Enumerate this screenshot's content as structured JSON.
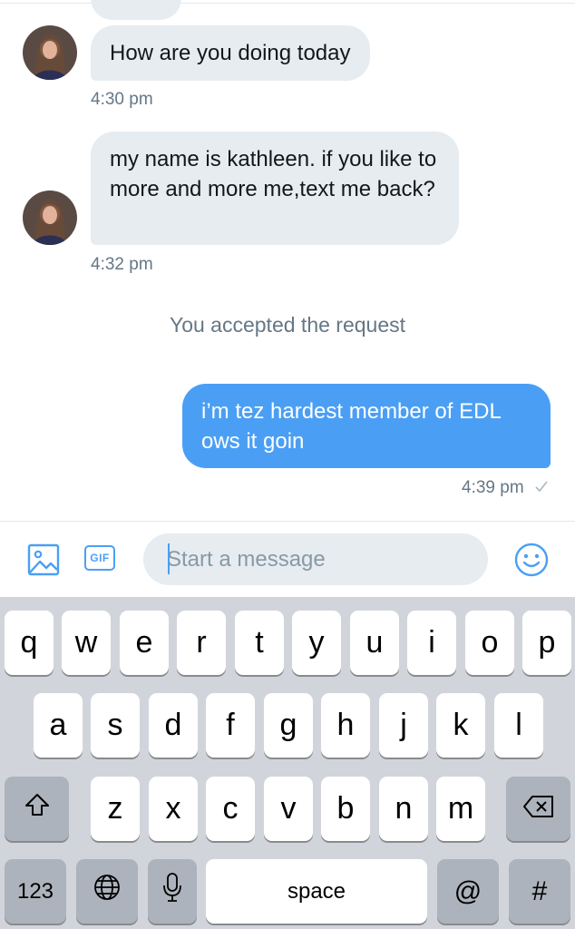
{
  "conversation": {
    "messages": [
      {
        "direction": "in",
        "text": "How are you doing today",
        "time": "4:30 pm"
      },
      {
        "direction": "in",
        "text": "my name is kathleen. if you like to more and more me,text me back?",
        "time": "4:32 pm"
      },
      {
        "direction": "out",
        "text": "i’m tez hardest member of EDL ows it goin",
        "time": "4:39 pm",
        "status_icon": "check-icon"
      }
    ],
    "system_notice": "You accepted the request"
  },
  "composer": {
    "placeholder": "Start a message",
    "media_icon": "image-icon",
    "gif_label": "GIF",
    "emoji_icon": "smiley-icon"
  },
  "keyboard": {
    "row1": [
      "q",
      "w",
      "e",
      "r",
      "t",
      "y",
      "u",
      "i",
      "o",
      "p"
    ],
    "row2": [
      "a",
      "s",
      "d",
      "f",
      "g",
      "h",
      "j",
      "k",
      "l"
    ],
    "row3": [
      "z",
      "x",
      "c",
      "v",
      "b",
      "n",
      "m"
    ],
    "numbers_label": "123",
    "space_label": "space",
    "at_label": "@",
    "hash_label": "#"
  },
  "colors": {
    "accent": "#4a9ff5",
    "incoming_bubble": "#e6ecf0",
    "secondary_text": "#657786",
    "keyboard_bg": "#d1d5db",
    "dark_key": "#acb3bc"
  }
}
